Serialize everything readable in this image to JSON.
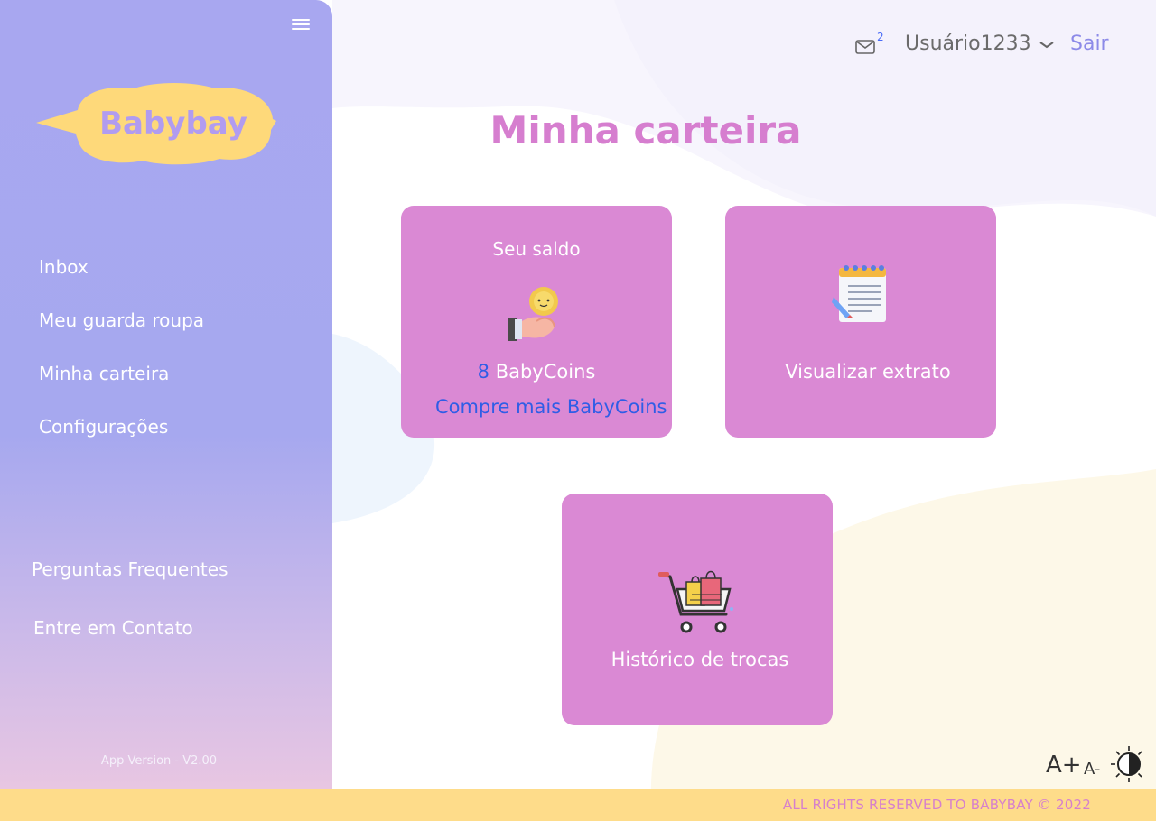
{
  "app": {
    "brand": "Babybay",
    "version": "App Version - V2.00"
  },
  "sidebar": {
    "items": [
      {
        "label": "Inbox"
      },
      {
        "label": "Meu guarda roupa"
      },
      {
        "label": "Minha carteira"
      },
      {
        "label": "Configurações"
      }
    ],
    "bottom_items": [
      {
        "label": "Perguntas Frequentes"
      },
      {
        "label": "Entre em Contato"
      }
    ]
  },
  "header": {
    "mail_count": "2",
    "username": "Usuário1233",
    "logout_label": "Sair"
  },
  "main": {
    "title": "Minha carteira",
    "balance_card": {
      "title": "Seu saldo",
      "amount": "8",
      "unit": "BabyCoins",
      "buy_link": "Compre mais BabyCoins"
    },
    "statement_card": {
      "label": "Visualizar extrato"
    },
    "history_card": {
      "label": "Histórico de trocas"
    }
  },
  "accessibility": {
    "font_increase": "A+",
    "font_decrease": "A-"
  },
  "footer": {
    "text": "ALL RIGHTS RESERVED TO BABYBAY © 2022"
  },
  "colors": {
    "sidebar": "#a8a7f0",
    "card": "#da89d4",
    "title": "#d67ecf",
    "link": "#2f5de6",
    "footer": "#fedc8a",
    "logo_bubble": "#fed97a"
  },
  "icons": [
    "menu-icon",
    "mail-icon",
    "chevron-down-icon",
    "coin-hand-icon",
    "notepad-icon",
    "shopping-cart-icon",
    "contrast-icon"
  ]
}
